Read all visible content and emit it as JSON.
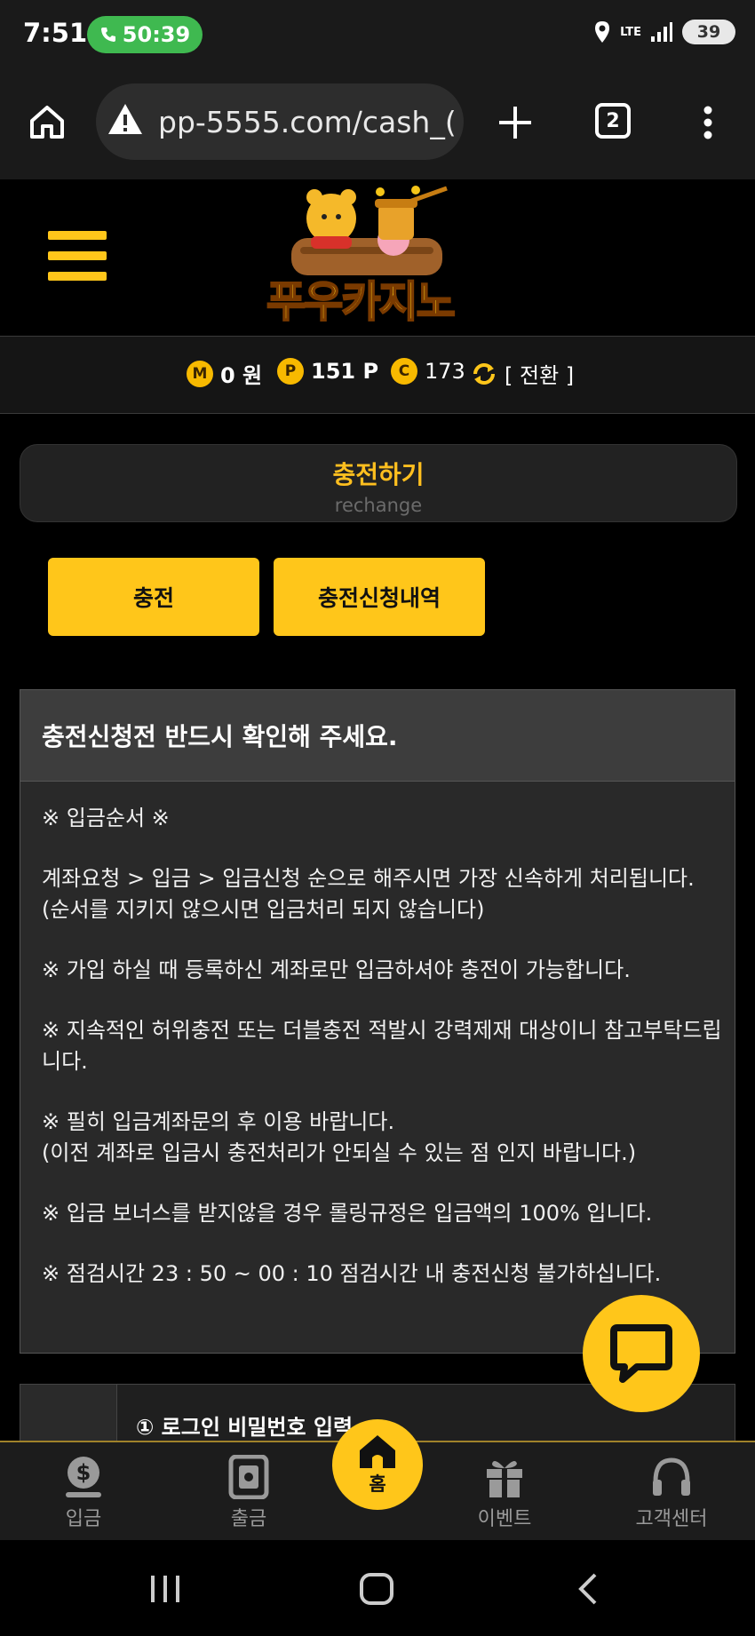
{
  "status_bar": {
    "time": "7:51",
    "call_timer": "50:39",
    "network": "LTE",
    "battery": "39"
  },
  "browser": {
    "url": "pp-5555.com/cash_(",
    "tab_count": "2",
    "icons": [
      "home-icon",
      "warning-icon",
      "plus-icon",
      "tabs-icon",
      "kebab-menu-icon"
    ]
  },
  "header": {
    "logo_text": "푸우카지노"
  },
  "points": {
    "m_badge": "M",
    "money": "0 원",
    "p_badge": "P",
    "point": "151 P",
    "c_badge": "C",
    "coin": "173",
    "convert_label": "[ 전환 ]"
  },
  "page_title": {
    "title": "충전하기",
    "subtitle": "rechange"
  },
  "tabs": {
    "charge": "충전",
    "history": "충전신청내역"
  },
  "notice": {
    "heading": "충전신청전 반드시 확인해 주세요.",
    "lines": [
      "※ 입금순서 ※",
      "계좌요청 > 입금 > 입금신청 순으로 해주시면 가장 신속하게 처리됩니다.\n(순서를 지키지 않으시면 입금처리 되지 않습니다)",
      "※ 가입 하실 때 등록하신 계좌로만 입금하셔야 충전이 가능합니다.",
      "※ 지속적인 허위충전 또는 더블충전 적발시 강력제재 대상이니 참고부탁드립니다.",
      "※ 필히 입금계좌문의 후 이용 바랍니다.\n(이전 계좌로 입금시 충전처리가 안되실 수 있는 점 인지 바랍니다.)",
      "※ 입금 보너스를 받지않을 경우 롤링규정은 입금액의 100% 입니다.",
      "※ 점검시간 23 : 50 ~ 00 : 10 점검시간 내 충전신청 불가하십니다."
    ]
  },
  "step": {
    "label": "① 로그인 비밀번호 입력"
  },
  "bottom_nav": {
    "deposit": "입금",
    "withdraw": "출금",
    "home": "홈",
    "event": "이벤트",
    "support": "고객센터"
  },
  "colors": {
    "accent": "#ffc61a",
    "background": "#000000",
    "panel": "#292929"
  }
}
